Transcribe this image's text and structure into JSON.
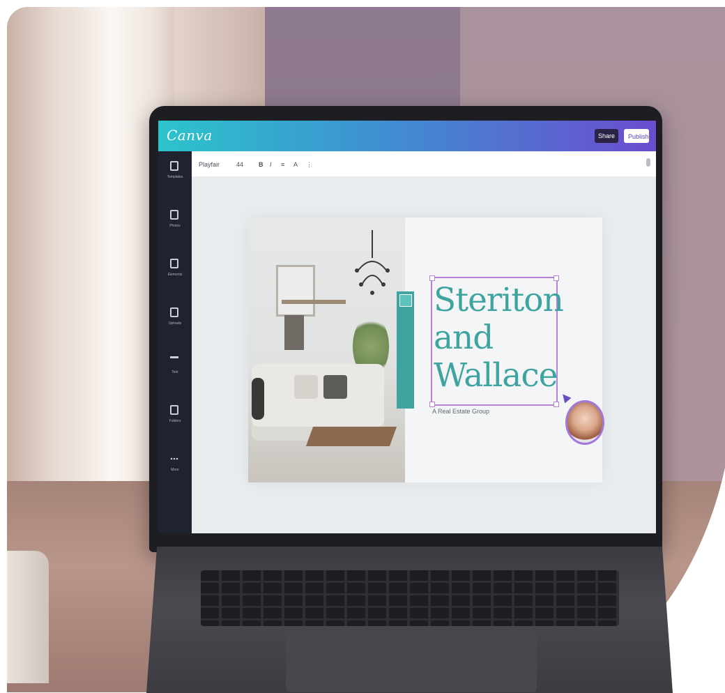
{
  "app": {
    "logo": "Canva",
    "share_label": "Share",
    "publish_label": "Publish"
  },
  "sidebar": {
    "items": [
      {
        "label": "Templates",
        "icon": "templates-icon"
      },
      {
        "label": "Photos",
        "icon": "photos-icon"
      },
      {
        "label": "Elements",
        "icon": "elements-icon"
      },
      {
        "label": "Uploads",
        "icon": "uploads-icon"
      },
      {
        "label": "Text",
        "icon": "text-icon"
      },
      {
        "label": "Folders",
        "icon": "folders-icon"
      },
      {
        "label": "More",
        "icon": "more-icon"
      }
    ]
  },
  "toolbar": {
    "font_name": "Playfair",
    "font_size": "44",
    "tools": [
      "B",
      "I",
      "≡",
      "A",
      "⋮"
    ]
  },
  "design": {
    "title_lines": [
      "Steriton",
      "and",
      "Wallace"
    ],
    "subtitle": "A Real Estate Group"
  },
  "colors": {
    "brand_gradient_start": "#2cc4cc",
    "brand_gradient_end": "#6b4ccf",
    "title_teal": "#3fa3a0",
    "selection_purple": "#b682d8"
  }
}
